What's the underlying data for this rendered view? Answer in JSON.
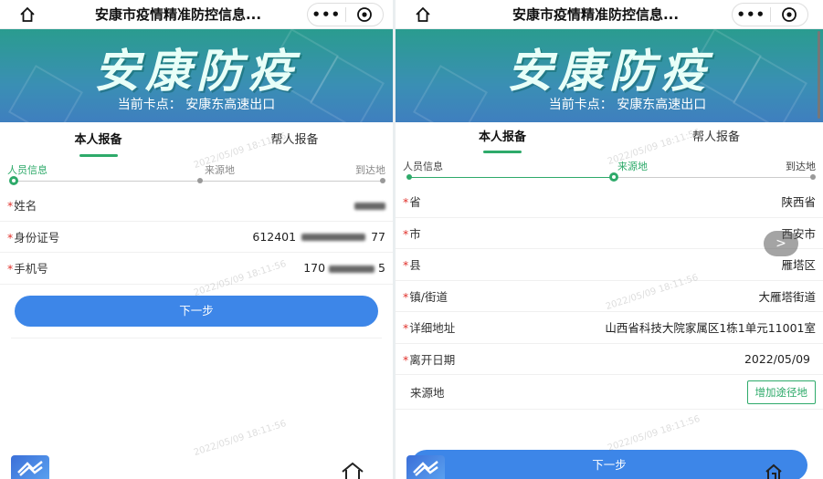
{
  "app": {
    "title": "安康市疫情精准防控信息...",
    "more_glyph": "•••",
    "banner_title": "安康防疫",
    "checkpoint_prefix": "当前卡点：",
    "checkpoint": "安康东高速出口"
  },
  "tabs": [
    "本人报备",
    "帮人报备"
  ],
  "steps": [
    "人员信息",
    "来源地",
    "到达地"
  ],
  "left_form": {
    "rows": [
      {
        "label": "姓名",
        "value": ""
      },
      {
        "label": "身份证号",
        "value_prefix": "612401",
        "value_suffix": "77"
      },
      {
        "label": "手机号",
        "value_prefix": "170",
        "value_suffix": "5"
      }
    ],
    "next_label": "下一步"
  },
  "right_form": {
    "rows": [
      {
        "label": "省",
        "value": "陕西省"
      },
      {
        "label": "市",
        "value": "西安市"
      },
      {
        "label": "县",
        "value": "雁塔区"
      },
      {
        "label": "镇/街道",
        "value": "大雁塔街道"
      },
      {
        "label": "详细地址",
        "value": "山西省科技大院家属区1栋1单元11001室"
      },
      {
        "label": "离开日期",
        "value": "2022/05/09"
      }
    ],
    "source_label": "来源地",
    "add_route_label": "增加途径地",
    "next_label": "下一步",
    "fab_glyph": ">"
  },
  "watermark": "2022/05/09 18:11:56",
  "colors": {
    "accent": "#2eaa6a",
    "button": "#3d86e8",
    "required": "#e0302a"
  }
}
